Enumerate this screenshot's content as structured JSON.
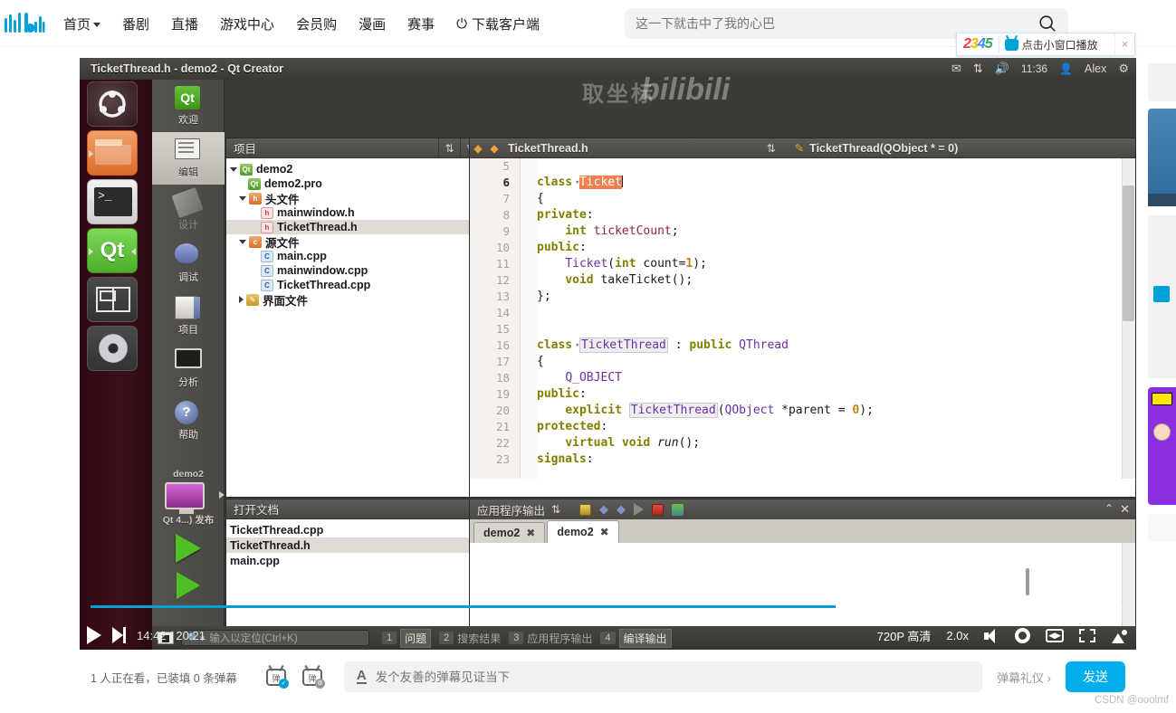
{
  "bili_nav": {
    "logo_text": "bilibili",
    "items": [
      {
        "label": "首页",
        "has_caret": true
      },
      {
        "label": "番剧",
        "has_caret": false
      },
      {
        "label": "直播",
        "has_caret": false
      },
      {
        "label": "游戏中心",
        "has_caret": false
      },
      {
        "label": "会员购",
        "has_caret": false
      },
      {
        "label": "漫画",
        "has_caret": false
      },
      {
        "label": "赛事",
        "has_caret": false
      },
      {
        "label": "下载客户端",
        "has_caret": false,
        "icon": "download-icon"
      }
    ],
    "search": {
      "placeholder": "这一下就击中了我的心巴",
      "value": "",
      "icon": "search-icon"
    }
  },
  "popup_2345": {
    "brand": "2345",
    "label": "点击小窗口播放",
    "close": "×",
    "icon": "tv-icon",
    "brand_colors": [
      "#e8453c",
      "#f8b400",
      "#4285f4",
      "#34a853"
    ]
  },
  "qt": {
    "titlebar": {
      "title": "TicketThread.h - demo2 - Qt Creator",
      "sys_mail": "✉",
      "sys_network": "⇅",
      "sys_volume": "🔊",
      "clock": "11:36",
      "user": "Alex",
      "user_icon": "user-icon",
      "gear": "⚙"
    },
    "launcher": [
      {
        "name": "ubuntu-dash",
        "glyph": ""
      },
      {
        "name": "files",
        "glyph": ""
      },
      {
        "name": "terminal",
        "glyph": ">_"
      },
      {
        "name": "qt-creator",
        "glyph": "Qt"
      },
      {
        "name": "workspace-switcher",
        "glyph": ""
      },
      {
        "name": "disc",
        "glyph": ""
      }
    ],
    "modes": [
      {
        "label": "欢迎",
        "icon": "qt-welcome-icon",
        "state": "normal"
      },
      {
        "label": "编辑",
        "icon": "edit-icon",
        "state": "active"
      },
      {
        "label": "设计",
        "icon": "design-icon",
        "state": "disabled"
      },
      {
        "label": "调试",
        "icon": "debug-bug-icon",
        "state": "normal"
      },
      {
        "label": "项目",
        "icon": "projects-icon",
        "state": "normal"
      },
      {
        "label": "分析",
        "icon": "analyze-icon",
        "state": "normal"
      },
      {
        "label": "帮助",
        "icon": "help-icon",
        "state": "normal"
      }
    ],
    "run_section": {
      "kit_name": "demo2",
      "target": "Qt 4...) 发布",
      "run_label": "run-button",
      "debug_label": "debug-button",
      "build_label": "build-button"
    },
    "project_panel": {
      "title": "项目",
      "buttons": [
        "filter-icon",
        "link-icon",
        "split-icon",
        "close-icon"
      ],
      "tree": [
        {
          "label": "demo2",
          "indent": 0,
          "twisty": "down",
          "icon": "qt-project-icon",
          "selected": false
        },
        {
          "label": "demo2.pro",
          "indent": 1,
          "twisty": "none",
          "icon": "qt-pro-icon",
          "selected": false
        },
        {
          "label": "头文件",
          "indent": 1,
          "twisty": "down",
          "icon": "folder-h-icon",
          "selected": false
        },
        {
          "label": "mainwindow.h",
          "indent": 2,
          "twisty": "none",
          "icon": "h-file-icon",
          "selected": false
        },
        {
          "label": "TicketThread.h",
          "indent": 2,
          "twisty": "none",
          "icon": "h-file-icon",
          "selected": true
        },
        {
          "label": "源文件",
          "indent": 1,
          "twisty": "down",
          "icon": "folder-c-icon",
          "selected": false
        },
        {
          "label": "main.cpp",
          "indent": 2,
          "twisty": "none",
          "icon": "cpp-file-icon",
          "selected": false
        },
        {
          "label": "mainwindow.cpp",
          "indent": 2,
          "twisty": "none",
          "icon": "cpp-file-icon",
          "selected": false
        },
        {
          "label": "TicketThread.cpp",
          "indent": 2,
          "twisty": "none",
          "icon": "cpp-file-icon",
          "selected": false
        },
        {
          "label": "界面文件",
          "indent": 1,
          "twisty": "right",
          "icon": "folder-ui-icon",
          "selected": false
        }
      ]
    },
    "docs_panel": {
      "title": "打开文档",
      "buttons": [
        "split-icon",
        "close-icon"
      ],
      "items": [
        {
          "label": "TicketThread.cpp",
          "selected": false
        },
        {
          "label": "TicketThread.h",
          "selected": true
        },
        {
          "label": "main.cpp",
          "selected": false
        }
      ]
    },
    "editor": {
      "filename": "TicketThread.h",
      "symbol": "TicketThread(QObject * = 0)",
      "nav_back": "◆",
      "nav_fwd": "◆",
      "lines": [
        {
          "n": "5",
          "fold": "",
          "cur": false
        },
        {
          "n": "6",
          "fold": "▾",
          "cur": true
        },
        {
          "n": "7",
          "fold": "",
          "cur": false
        },
        {
          "n": "8",
          "fold": "",
          "cur": false
        },
        {
          "n": "9",
          "fold": "",
          "cur": false
        },
        {
          "n": "10",
          "fold": "",
          "cur": false
        },
        {
          "n": "11",
          "fold": "",
          "cur": false
        },
        {
          "n": "12",
          "fold": "",
          "cur": false
        },
        {
          "n": "13",
          "fold": "",
          "cur": false
        },
        {
          "n": "14",
          "fold": "",
          "cur": false
        },
        {
          "n": "15",
          "fold": "",
          "cur": false
        },
        {
          "n": "16",
          "fold": "▾",
          "cur": false
        },
        {
          "n": "17",
          "fold": "",
          "cur": false
        },
        {
          "n": "18",
          "fold": "",
          "cur": false
        },
        {
          "n": "19",
          "fold": "",
          "cur": false
        },
        {
          "n": "20",
          "fold": "",
          "cur": false
        },
        {
          "n": "21",
          "fold": "",
          "cur": false
        },
        {
          "n": "22",
          "fold": "",
          "cur": false
        },
        {
          "n": "23",
          "fold": "",
          "cur": false
        }
      ],
      "code_text": [
        "",
        "class Ticket",
        "{",
        "private:",
        "    int ticketCount;",
        "public:",
        "    Ticket(int count=1);",
        "    void takeTicket();",
        "};",
        "",
        "",
        "class TicketThread : public QThread",
        "{",
        "    Q_OBJECT",
        "public:",
        "    explicit TicketThread(QObject *parent = 0);",
        "protected:",
        "    virtual void run();",
        "signals:"
      ]
    },
    "output_panel": {
      "title": "应用程序输出",
      "tools": [
        "clear-icon",
        "prev-icon",
        "next-icon",
        "run-icon",
        "stop-icon",
        "attach-icon"
      ],
      "minimize": "⌃",
      "close": "✕",
      "tabs": [
        {
          "label": "demo2",
          "active": false,
          "close": "✖"
        },
        {
          "label": "demo2",
          "active": true,
          "close": "✖"
        }
      ],
      "body_text": ""
    },
    "status_bar": {
      "locator_placeholder": "输入以定位(Ctrl+K)",
      "locator_icon": "search-icon",
      "sidebar_toggle": "sidebar-toggle-icon",
      "panes": [
        {
          "num": "1",
          "label": "问题",
          "active": true
        },
        {
          "num": "2",
          "label": "搜索结果",
          "active": false
        },
        {
          "num": "3",
          "label": "应用程序输出",
          "active": false
        },
        {
          "num": "4",
          "label": "编译输出",
          "active": true
        }
      ]
    },
    "watermark": "取坐标"
  },
  "player": {
    "progress_percent": 72,
    "buffer_percent": 73,
    "current_time": "14:42",
    "total_time": "20:21",
    "time_sep": "/",
    "play_icon": "play-icon",
    "next_icon": "next-icon",
    "quality": "720P 高清",
    "speed": "2.0x",
    "volume_icon": "volume-icon",
    "settings_icon": "gear-icon",
    "widescreen_icon": "widescreen-icon",
    "fullscreen_icon": "fullscreen-icon",
    "theater_icon": "tv-fullscreen-icon"
  },
  "danmaku": {
    "status": "1 人正在看，已装填 0 条弹幕",
    "icon_danmu_on": "danmaku-toggle-icon",
    "icon_danmu_settings": "danmaku-settings-icon",
    "style_icon": "font-style-icon",
    "input_placeholder": "发个友善的弹幕见证当下",
    "input_value": "",
    "etiquette": "弹幕礼仪 ›",
    "send_label": "发送",
    "send_color": "#00aeec"
  },
  "watermark_csdn": "CSDN @ooolmf"
}
